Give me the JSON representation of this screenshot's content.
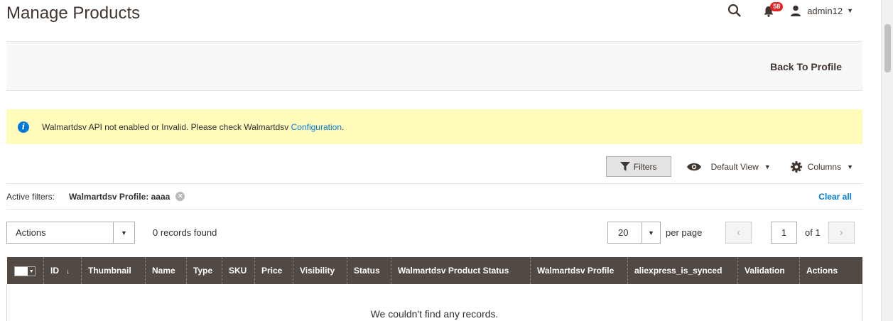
{
  "header": {
    "title": "Manage Products",
    "notification_count": "58",
    "username": "admin12"
  },
  "page_actions": {
    "back_label": "Back To Profile"
  },
  "notice": {
    "message": "Walmartdsv API not enabled or Invalid. Please check Walmartdsv ",
    "link_text": "Configuration",
    "suffix": "."
  },
  "grid_controls": {
    "filters_label": "Filters",
    "view_label": "Default View",
    "columns_label": "Columns"
  },
  "active_filters": {
    "label": "Active filters:",
    "chip": "Walmartdsv Profile: aaaa",
    "clear_all": "Clear all"
  },
  "toolbar": {
    "actions_label": "Actions",
    "records_found": "0 records found",
    "per_page_value": "20",
    "per_page_label": "per page",
    "current_page": "1",
    "total_pages_label": "of 1"
  },
  "table": {
    "columns": [
      "ID",
      "Thumbnail",
      "Name",
      "Type",
      "SKU",
      "Price",
      "Visibility",
      "Status",
      "Walmartdsv Product Status",
      "Walmartdsv Profile",
      "aliexpress_is_synced",
      "Validation",
      "Actions"
    ],
    "empty_message": "We couldn't find any records."
  },
  "colors": {
    "header_bg": "#514943",
    "notice_bg": "#fffbbb",
    "link": "#007bdb",
    "badge": "#e22626"
  }
}
